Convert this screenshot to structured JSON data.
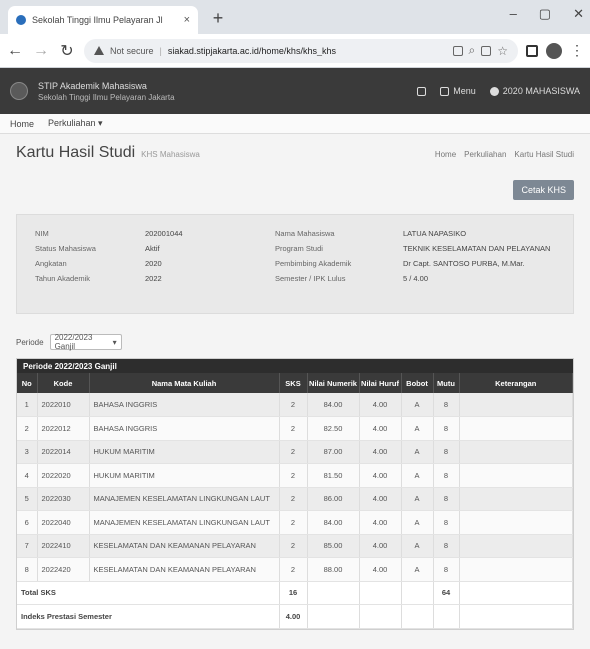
{
  "browser": {
    "tab_title": "Sekolah Tinggi Ilmu Pelayaran Jl",
    "tab_close": "×",
    "new_tab": "+",
    "win_min": "–",
    "win_max": "▢",
    "win_close": "✕",
    "secure_label": "Not secure",
    "url": "siakad.stipjakarta.ac.id/home/khs/khs_khs"
  },
  "app": {
    "name_line1": "STIP Akademik Mahasiswa",
    "name_line2": "Sekolah Tinggi Ilmu Pelayaran Jakarta",
    "menu_label": "Menu",
    "user_label": "2020 MAHASISWA"
  },
  "menubar": {
    "items": [
      "Home",
      "Perkuliahan"
    ]
  },
  "page": {
    "title": "Kartu Hasil Studi",
    "subtitle": "KHS Mahasiswa",
    "crumbs": [
      "Home",
      "Perkuliahan",
      "Kartu Hasil Studi"
    ],
    "print_button": "Cetak KHS"
  },
  "info": {
    "left": [
      {
        "label": "NIM",
        "value": "202001044"
      },
      {
        "label": "Status Mahasiswa",
        "value": "Aktif"
      },
      {
        "label": "Angkatan",
        "value": "2020"
      },
      {
        "label": "Tahun Akademik",
        "value": "2022"
      }
    ],
    "right": [
      {
        "label": "Nama Mahasiswa",
        "value": "LATUA NAPASIKO"
      },
      {
        "label": "Program Studi",
        "value": "TEKNIK KESELAMATAN DAN PELAYANAN"
      },
      {
        "label": "Pembimbing Akademik",
        "value": "Dr Capt. SANTOSO PURBA, M.Mar."
      },
      {
        "label": "Semester / IPK Lulus",
        "value": "5 / 4.00"
      }
    ]
  },
  "period": {
    "label": "Periode",
    "selected": "2022/2023 Ganjil"
  },
  "table": {
    "caption": "Periode 2022/2023 Ganjil",
    "headers": [
      "No",
      "Kode",
      "Nama Mata Kuliah",
      "SKS",
      "Nilai Numerik",
      "Nilai Huruf",
      "Bobot",
      "Mutu",
      "Keterangan"
    ],
    "rows": [
      [
        "1",
        "2022010",
        "BAHASA INGGRIS",
        "2",
        "84.00",
        "4.00",
        "A",
        "8",
        ""
      ],
      [
        "2",
        "2022012",
        "BAHASA INGGRIS",
        "2",
        "82.50",
        "4.00",
        "A",
        "8",
        ""
      ],
      [
        "3",
        "2022014",
        "HUKUM MARITIM",
        "2",
        "87.00",
        "4.00",
        "A",
        "8",
        ""
      ],
      [
        "4",
        "2022020",
        "HUKUM MARITIM",
        "2",
        "81.50",
        "4.00",
        "A",
        "8",
        ""
      ],
      [
        "5",
        "2022030",
        "MANAJEMEN KESELAMATAN LINGKUNGAN LAUT",
        "2",
        "86.00",
        "4.00",
        "A",
        "8",
        ""
      ],
      [
        "6",
        "2022040",
        "MANAJEMEN KESELAMATAN LINGKUNGAN LAUT",
        "2",
        "84.00",
        "4.00",
        "A",
        "8",
        ""
      ],
      [
        "7",
        "2022410",
        "KESELAMATAN DAN KEAMANAN PELAYARAN",
        "2",
        "85.00",
        "4.00",
        "A",
        "8",
        ""
      ],
      [
        "8",
        "2022420",
        "KESELAMATAN DAN KEAMANAN PELAYARAN",
        "2",
        "88.00",
        "4.00",
        "A",
        "8",
        ""
      ]
    ],
    "total_label": "Total SKS",
    "total_sks": "16",
    "total_mutu": "64",
    "ips_label": "Indeks Prestasi Semester",
    "ips_value": "4.00"
  }
}
